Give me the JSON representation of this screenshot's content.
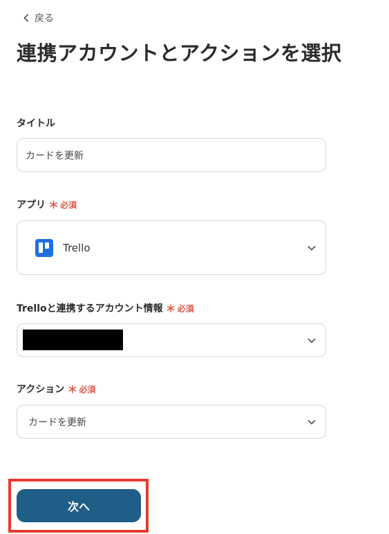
{
  "nav": {
    "back_label": "戻る"
  },
  "page": {
    "title": "連携アカウントとアクションを選択"
  },
  "form": {
    "required_label": "必須",
    "title_field": {
      "label": "タイトル",
      "value": "カードを更新"
    },
    "app_field": {
      "label": "アプリ",
      "value": "Trello",
      "icon": "trello-icon"
    },
    "account_field": {
      "label": "Trelloと連携するアカウント情報",
      "value_redacted": true
    },
    "action_field": {
      "label": "アクション",
      "value": "カードを更新"
    }
  },
  "footer": {
    "next_label": "次へ"
  },
  "colors": {
    "primary_button": "#1f5e86",
    "required": "#e2574c",
    "highlight": "#e93a2f",
    "trello": "#1d6fe0"
  }
}
